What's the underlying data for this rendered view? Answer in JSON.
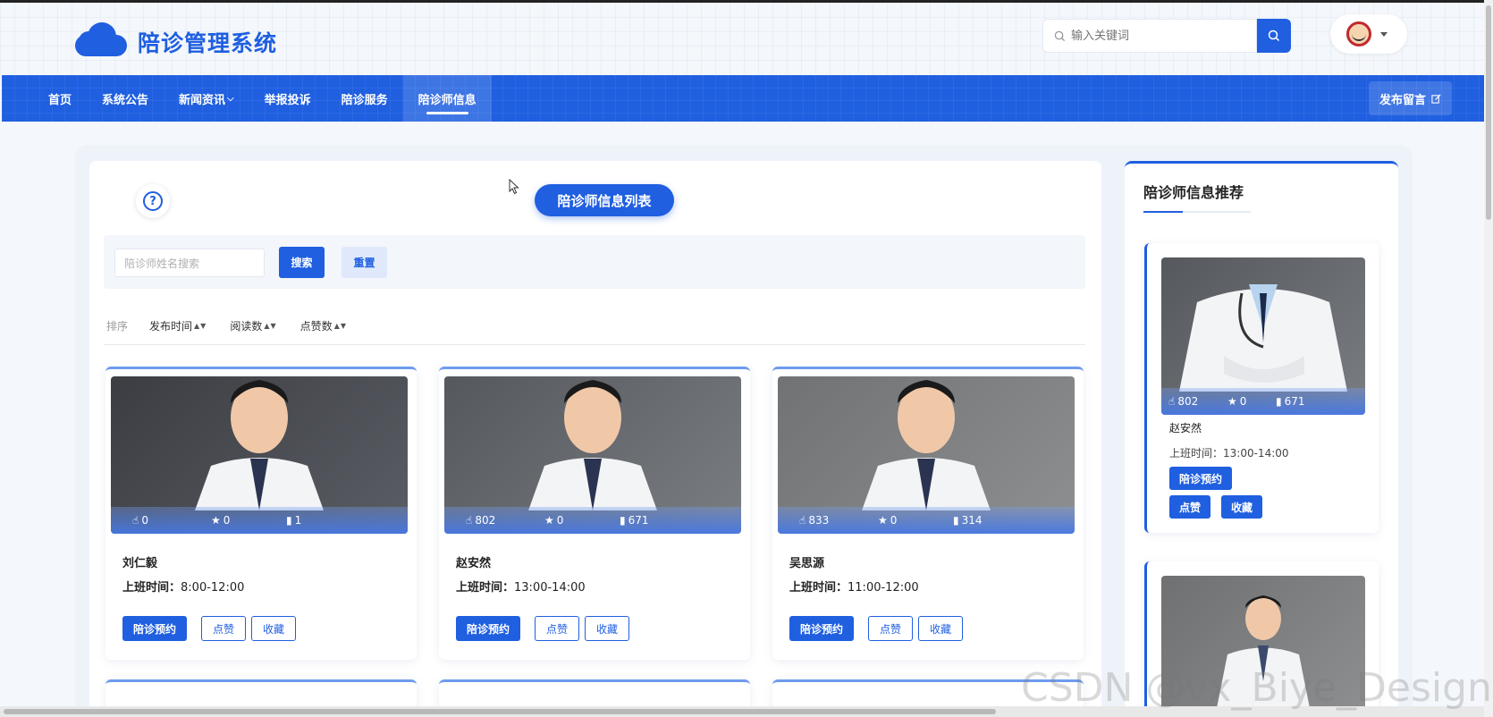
{
  "header": {
    "site_title": "陪诊管理系统",
    "search_placeholder": "输入关键词"
  },
  "nav": {
    "items": [
      "首页",
      "系统公告",
      "新闻资讯",
      "举报投诉",
      "陪诊服务",
      "陪诊师信息"
    ],
    "active": "陪诊师信息",
    "message_button": "发布留言"
  },
  "main": {
    "list_title": "陪诊师信息列表",
    "filter": {
      "name_placeholder": "陪诊师姓名搜索",
      "search_label": "搜索",
      "reset_label": "重置"
    },
    "sort": {
      "label": "排序",
      "options": [
        "发布时间",
        "阅读数",
        "点赞数"
      ]
    },
    "hours_label": "上班时间：",
    "buttons": {
      "book": "陪诊预约",
      "like": "点赞",
      "favorite": "收藏"
    },
    "cards": [
      {
        "name": "刘仁毅",
        "hours": "8:00-12:00",
        "likes": "0",
        "stars": "0",
        "views": "1",
        "colors": [
          "#3b3d42",
          "#5a5d64"
        ]
      },
      {
        "name": "赵安然",
        "hours": "13:00-14:00",
        "likes": "802",
        "stars": "0",
        "views": "671",
        "colors": [
          "#55585d",
          "#7a7d82"
        ]
      },
      {
        "name": "吴思源",
        "hours": "11:00-12:00",
        "likes": "833",
        "stars": "0",
        "views": "314",
        "colors": [
          "#707274",
          "#8d8f91"
        ]
      }
    ]
  },
  "sidebar": {
    "title": "陪诊师信息推荐",
    "cards": [
      {
        "name": "赵安然",
        "hours_label": "上班时间：",
        "hours": "13:00-14:00",
        "likes": "802",
        "stars": "0",
        "views": "671",
        "book": "陪诊预约",
        "like": "点赞",
        "favorite": "收藏"
      }
    ]
  },
  "watermark": "CSDN @vx_Biye_Design",
  "colors": {
    "primary": "#1f5fe0",
    "card_border": "#6f9bef"
  }
}
